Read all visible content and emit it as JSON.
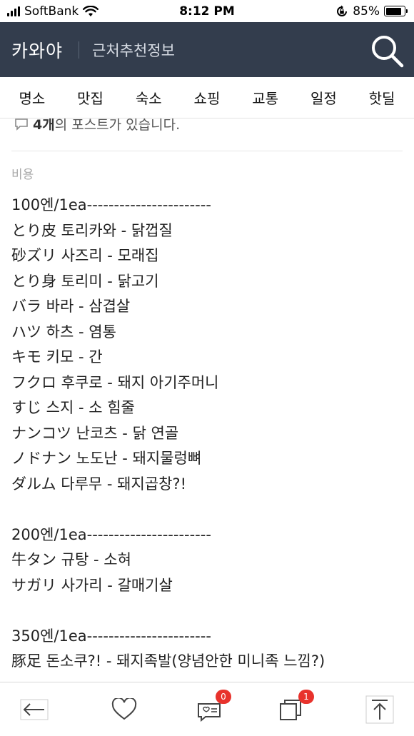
{
  "status_bar": {
    "carrier": "SoftBank",
    "time": "8:12 PM",
    "battery_percent": 85,
    "battery_label": "85%"
  },
  "header": {
    "brand": "카와야",
    "subtitle": "근처추천정보",
    "search_icon": "search-icon",
    "background_color": "#333d4d"
  },
  "nav": {
    "items": [
      {
        "label": "명소"
      },
      {
        "label": "맛집"
      },
      {
        "label": "숙소"
      },
      {
        "label": "쇼핑"
      },
      {
        "label": "교통"
      },
      {
        "label": "일정"
      },
      {
        "label": "핫딜"
      }
    ]
  },
  "content": {
    "post_count_number": "4개",
    "post_count_text": "의 포스트가 있습니다.",
    "section_label": "비용",
    "lines": [
      "100엔/1ea-----------------------",
      "とり皮 토리카와 - 닭껍질",
      "砂ズリ 사즈리 - 모래집",
      "とり身 토리미 - 닭고기",
      "バラ 바라 - 삼겹살",
      "ハツ 하츠 - 염통",
      "キモ 키모 - 간",
      "フクロ 후쿠로 - 돼지 아기주머니",
      "すじ 스지 - 소 힘줄",
      "ナンコツ 난코츠 - 닭 연골",
      "ノドナン 노도난 - 돼지물렁뼈",
      "ダルム 다루무 - 돼지곱창?!",
      "",
      "200엔/1ea-----------------------",
      "牛タン 규탕 - 소혀",
      "サガリ 사가리 - 갈매기살",
      "",
      "350엔/1ea-----------------------",
      "豚足 돈소쿠?! - 돼지족발(양념안한 미니족 느낌?)"
    ]
  },
  "toolbar": {
    "back_icon": "arrow-left-icon",
    "like_icon": "heart-icon",
    "comments_icon": "comment-list-icon",
    "comments_badge": "0",
    "tabs_icon": "tabs-icon",
    "tabs_badge": "1",
    "top_icon": "scroll-top-icon",
    "badge_color": "#e8322c"
  }
}
